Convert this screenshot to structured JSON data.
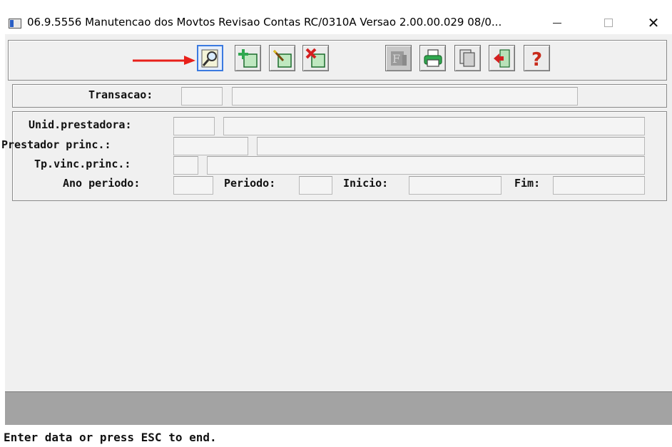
{
  "window": {
    "title": "06.9.5556 Manutencao  dos Movtos Revisao Contas RC/0310A Versao 2.00.00.029 08/0..."
  },
  "toolbar": {
    "buttons": [
      {
        "id": "search",
        "icon": "search-icon",
        "enabled": true,
        "highlighted": true
      },
      {
        "id": "add",
        "icon": "add-record-icon",
        "enabled": true
      },
      {
        "id": "edit",
        "icon": "edit-record-icon",
        "enabled": true
      },
      {
        "id": "delete",
        "icon": "delete-record-icon",
        "enabled": true
      },
      {
        "id": "filter",
        "icon": "filter-icon",
        "enabled": false
      },
      {
        "id": "print",
        "icon": "printer-icon",
        "enabled": true
      },
      {
        "id": "copy",
        "icon": "copy-icon",
        "enabled": true
      },
      {
        "id": "exit",
        "icon": "exit-door-icon",
        "enabled": true
      },
      {
        "id": "help",
        "icon": "help-question-icon",
        "enabled": true
      }
    ],
    "annotation_arrow_color": "#e8201a"
  },
  "form": {
    "transacao": {
      "label": "Transacao:",
      "code": "",
      "description": ""
    },
    "unid_prestadora": {
      "label": "Unid.prestadora:",
      "code": "",
      "description": ""
    },
    "prestador_princ": {
      "label": "Prestador princ.:",
      "code": "",
      "description": ""
    },
    "tp_vinc_princ": {
      "label": "Tp.vinc.princ.:",
      "code": "",
      "description": ""
    },
    "ano_periodo": {
      "label": "Ano periodo:",
      "value": ""
    },
    "periodo": {
      "label": "Periodo:",
      "value": ""
    },
    "inicio": {
      "label": "Inicio:",
      "value": ""
    },
    "fim": {
      "label": "Fim:",
      "value": ""
    }
  },
  "status": {
    "message": "Enter data or press ESC to end."
  },
  "colors": {
    "form_bg": "#f0f0f0",
    "status_band": "#a3a3a3",
    "highlight_border": "#3b7ae0",
    "icon_green": "#2fa84f",
    "icon_red": "#d42020"
  }
}
